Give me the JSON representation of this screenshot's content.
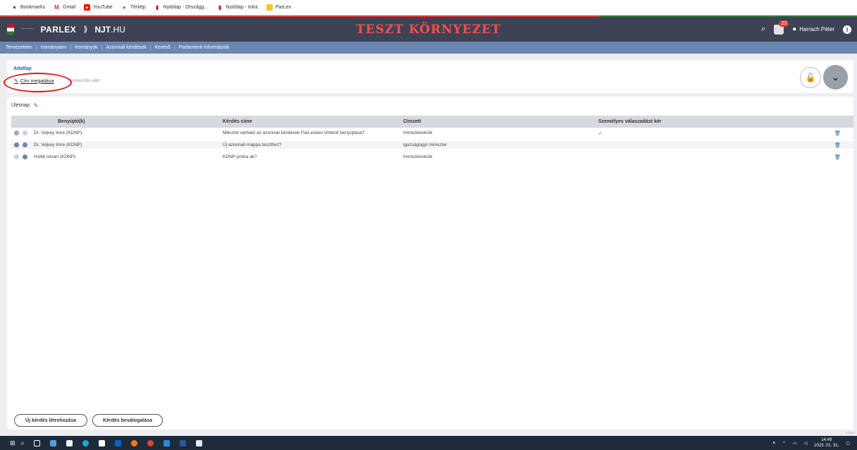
{
  "bookmarks": [
    {
      "label": "Bookmarks",
      "icon": "star-icon",
      "color": "#555555"
    },
    {
      "label": "Gmail",
      "icon": "gmail-icon",
      "color": "#d93025"
    },
    {
      "label": "YouTube",
      "icon": "youtube-icon",
      "color": "#ff0000"
    },
    {
      "label": "Térkép",
      "icon": "maps-icon",
      "color": "#34a853"
    },
    {
      "label": "Nyitólap - Országg...",
      "icon": "parliament-icon",
      "color": "#c8102e"
    },
    {
      "label": "Nyitólap - Intra",
      "icon": "parliament-icon",
      "color": "#c8102e"
    },
    {
      "label": "ParLex",
      "icon": "folder-icon",
      "color": "#f4c430"
    }
  ],
  "header": {
    "logo_text": "PARLEX",
    "njt_text": "NJT",
    "njt_suffix": ".HU",
    "environment_banner": "TESZT KÖRNYEZET",
    "notification_count": "23",
    "user_name": "Harrach Péter"
  },
  "nav": [
    "Tervezeteim",
    "Irományaim",
    "Irományok",
    "Azonnali kérdések",
    "Kereső",
    "Parlamenti Információk"
  ],
  "datasheet": {
    "title": "Adatlap",
    "step_label": "Cím megadása",
    "step_status": "Szerkesztés alatt"
  },
  "table": {
    "session_label": "Ülésnap:",
    "headers": [
      "Benyújtó(k)",
      "Kérdés címe",
      "Címzett",
      "Személyes válaszadást kér"
    ],
    "rows": [
      {
        "submitter": "Dr. Vejkey Imre (KDNP)",
        "title": "Mikortól várható az azonnali kérdések ParLexben történő benyújtása?",
        "recipient": "miniszterelnök",
        "personal": "✓"
      },
      {
        "submitter": "Dr. Vejkey Imre (KDNP)",
        "title": "Új azonnali mappa teszthez?",
        "recipient": "igazságügyi miniszter",
        "personal": ""
      },
      {
        "submitter": "Hollik István (KDNP)",
        "title": "KDNP próba ak?",
        "recipient": "miniszterelnök",
        "personal": ""
      }
    ]
  },
  "buttons": {
    "new_question": "Új kérdés létrehozása",
    "select_questions": "Kérdés beválogatása"
  },
  "version": "0.2.81.1",
  "clock": {
    "time": "14:49",
    "date": "2023. 01. 31."
  },
  "colors": {
    "header_bg": "#3e4255",
    "nav_bg": "#6b86b2",
    "banner": "#ff4d4d",
    "accent": "#1a66a9",
    "highlight_oval": "#e21a1a"
  }
}
